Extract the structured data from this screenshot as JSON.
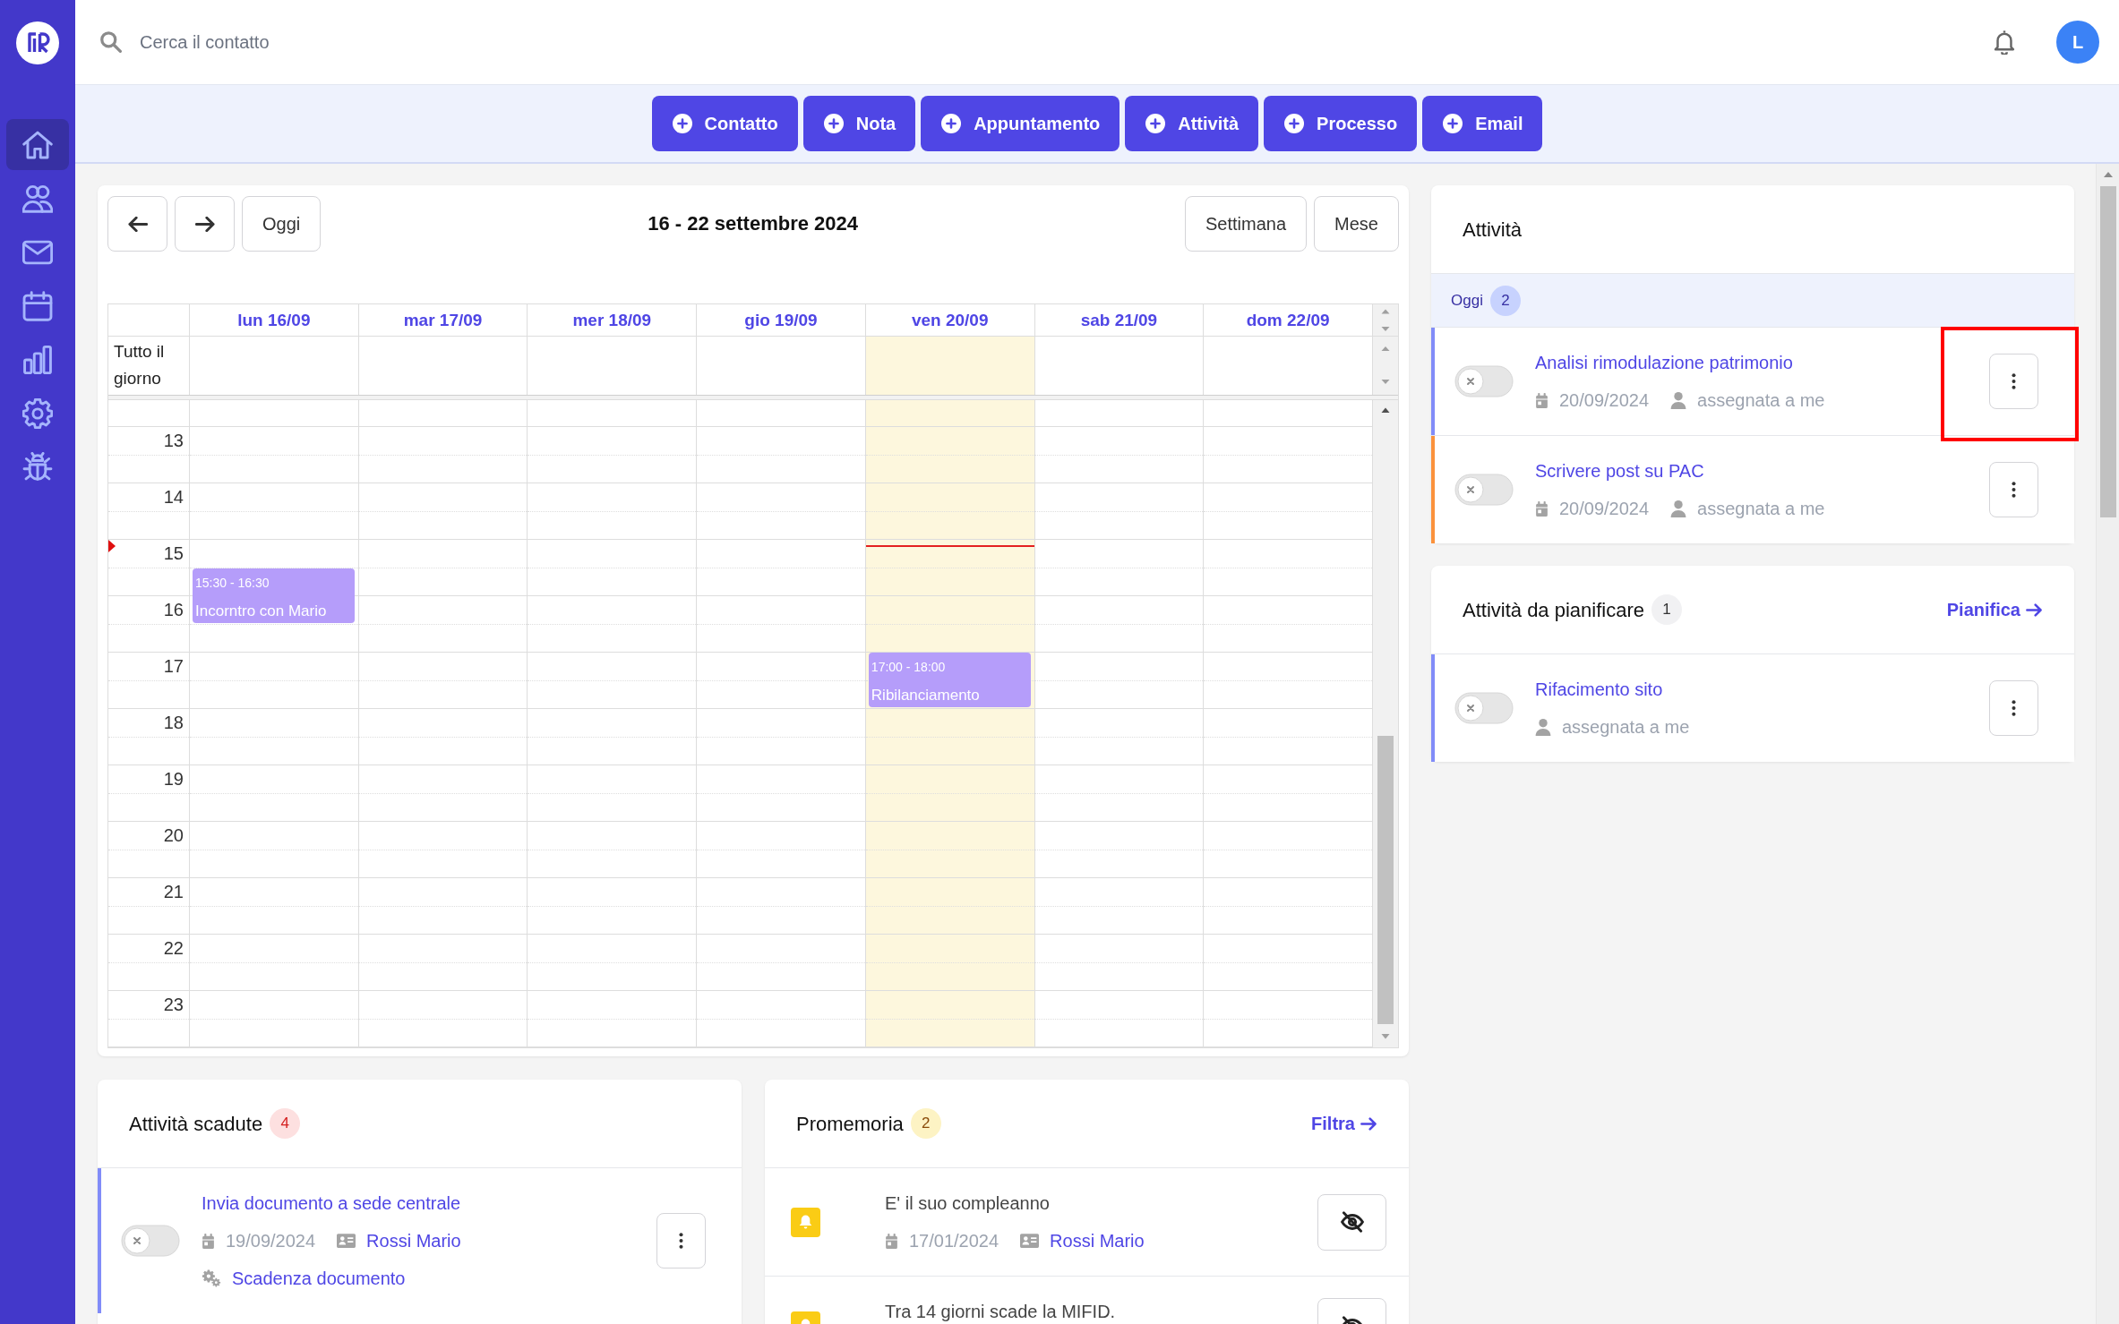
{
  "sidebar": {
    "items": [
      {
        "selected": true
      },
      {
        "selected": false
      },
      {
        "selected": false
      },
      {
        "selected": false
      },
      {
        "selected": false
      },
      {
        "selected": false
      },
      {
        "selected": false
      }
    ]
  },
  "topbar": {
    "search": {
      "placeholder": "Cerca il contatto"
    },
    "user": {
      "initial": "L"
    }
  },
  "quick_actions": [
    {
      "label": "Contatto"
    },
    {
      "label": "Nota"
    },
    {
      "label": "Appuntamento"
    },
    {
      "label": "Attività"
    },
    {
      "label": "Processo"
    },
    {
      "label": "Email"
    }
  ],
  "calendar": {
    "today_button": "Oggi",
    "title": "16 - 22 settembre 2024",
    "views": [
      {
        "label": "Settimana",
        "selected": false
      },
      {
        "label": "Mese",
        "selected": false
      }
    ],
    "all_day_label": "Tutto il giorno",
    "hours": [
      "13",
      "14",
      "15",
      "16",
      "17",
      "18",
      "19",
      "20",
      "21",
      "22",
      "23"
    ],
    "days": [
      {
        "label": "lun 16/09",
        "today": false,
        "events": [
          {
            "time": "15:30 - 16:30",
            "title": "Incorntro con Mario"
          }
        ]
      },
      {
        "label": "mar 17/09",
        "today": false
      },
      {
        "label": "mer 18/09",
        "today": false
      },
      {
        "label": "gio 19/09",
        "today": false
      },
      {
        "label": "ven 20/09",
        "today": true,
        "events": [
          {
            "time": "17:00 - 18:00",
            "title": "Ribilanciamento"
          }
        ]
      },
      {
        "label": "sab 21/09",
        "today": false
      },
      {
        "label": "dom 22/09",
        "today": false
      }
    ]
  },
  "activities": {
    "title": "Attività",
    "groups": [
      {
        "label": "Oggi",
        "count": "2",
        "tasks": [
          {
            "title": "Analisi rimodulazione patrimonio",
            "date": "20/09/2024",
            "assignee": "assegnata a me",
            "done": false,
            "color": "#818cf8",
            "highlighted": true
          },
          {
            "title": "Scrivere post su PAC",
            "date": "20/09/2024",
            "assignee": "assegnata a me",
            "done": false,
            "color": "#fb923c",
            "highlighted": false
          }
        ]
      }
    ]
  },
  "to_schedule": {
    "title": "Attività da pianificare",
    "count": "1",
    "link": "Pianifica",
    "tasks": [
      {
        "title": "Rifacimento sito",
        "assignee": "assegnata a me",
        "done": false,
        "color": "#818cf8"
      }
    ]
  },
  "overdue": {
    "title": "Attività scadute",
    "count": "4",
    "tasks": [
      {
        "title": "Invia documento a sede centrale",
        "date": "19/09/2024",
        "contact": "Rossi Mario",
        "category": "Scadenza documento",
        "done": false,
        "color": "#818cf8"
      }
    ]
  },
  "reminders": {
    "title": "Promemoria",
    "count": "2",
    "link": "Filtra",
    "items": [
      {
        "text": "E' il suo compleanno",
        "date": "17/01/2024",
        "contact": "Rossi Mario"
      },
      {
        "text": "Tra 14 giorni scade la MIFID."
      }
    ]
  }
}
